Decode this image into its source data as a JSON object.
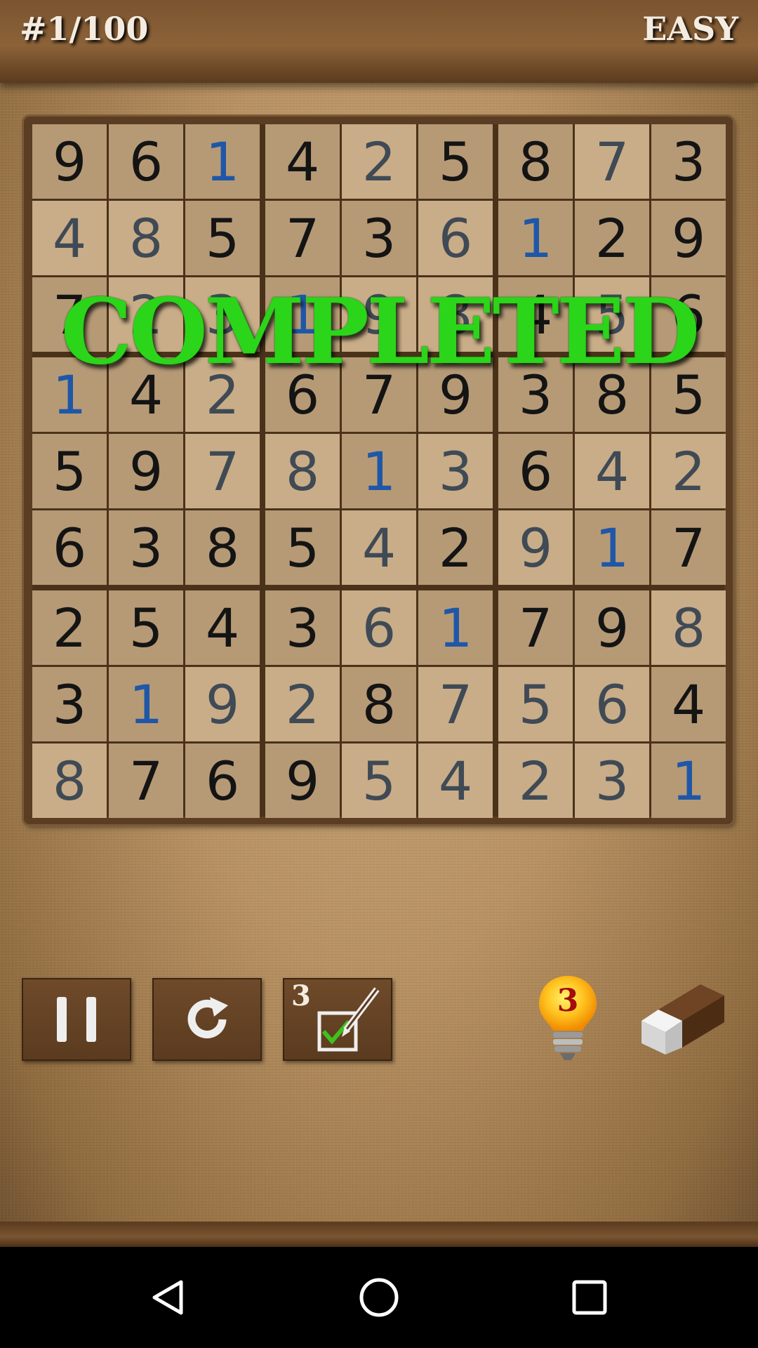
{
  "header": {
    "puzzle_number": "#1/100",
    "difficulty": "EASY"
  },
  "overlay": {
    "completed_text": "COMPLETED"
  },
  "board": {
    "cells": [
      [
        9,
        6,
        1,
        4,
        2,
        5,
        8,
        7,
        3
      ],
      [
        4,
        8,
        5,
        7,
        3,
        6,
        1,
        2,
        9
      ],
      [
        7,
        2,
        3,
        1,
        9,
        8,
        4,
        5,
        6
      ],
      [
        1,
        4,
        2,
        6,
        7,
        9,
        3,
        8,
        5
      ],
      [
        5,
        9,
        7,
        8,
        1,
        3,
        6,
        4,
        2
      ],
      [
        6,
        3,
        8,
        5,
        4,
        2,
        9,
        1,
        7
      ],
      [
        2,
        5,
        4,
        3,
        6,
        1,
        7,
        9,
        8
      ],
      [
        3,
        1,
        9,
        2,
        8,
        7,
        5,
        6,
        4
      ],
      [
        8,
        7,
        6,
        9,
        5,
        4,
        2,
        3,
        1
      ]
    ],
    "kinds": [
      [
        "g",
        "g",
        "h",
        "g",
        "e",
        "g",
        "g",
        "e",
        "g"
      ],
      [
        "e",
        "e",
        "g",
        "g",
        "g",
        "e",
        "h",
        "g",
        "g"
      ],
      [
        "g",
        "e",
        "e",
        "h",
        "e",
        "e",
        "g",
        "e",
        "g"
      ],
      [
        "h",
        "g",
        "e",
        "g",
        "g",
        "g",
        "g",
        "g",
        "g"
      ],
      [
        "g",
        "g",
        "e",
        "e",
        "h",
        "e",
        "g",
        "e",
        "e"
      ],
      [
        "g",
        "g",
        "g",
        "g",
        "e",
        "g",
        "e",
        "h",
        "g"
      ],
      [
        "g",
        "g",
        "g",
        "g",
        "e",
        "h",
        "g",
        "g",
        "e"
      ],
      [
        "g",
        "h",
        "e",
        "e",
        "g",
        "e",
        "e",
        "e",
        "g"
      ],
      [
        "e",
        "g",
        "g",
        "g",
        "e",
        "e",
        "e",
        "e",
        "h"
      ]
    ],
    "colors": {
      "given": "#141414",
      "entered": "#3f4a55",
      "hint": "#1f57a8"
    }
  },
  "toolbar": {
    "notes_count": "3",
    "hints_remaining": "3",
    "icons": [
      "pause-icon",
      "restart-icon",
      "notes-icon",
      "lightbulb-icon",
      "eraser-icon"
    ]
  },
  "navigation": {
    "icons": [
      "back-icon",
      "home-icon",
      "recents-icon"
    ]
  }
}
